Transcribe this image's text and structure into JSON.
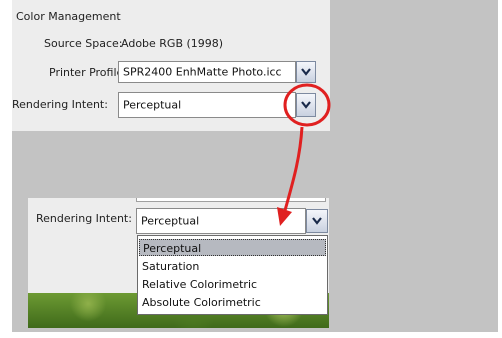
{
  "color_management": {
    "title": "Color Management",
    "source_space_label": "Source Space:",
    "source_space_value": "Adobe RGB (1998)",
    "printer_profile_label": "Printer Profile:",
    "printer_profile_value": "SPR2400 EnhMatte Photo.icc",
    "rendering_intent_label": "Rendering Intent:",
    "rendering_intent_value": "Perceptual"
  },
  "dropdown_expanded": {
    "rendering_intent_label": "Rendering Intent:",
    "rendering_intent_value": "Perceptual",
    "options": [
      "Perceptual",
      "Saturation",
      "Relative Colorimetric",
      "Absolute Colorimetric"
    ],
    "selected_index": 0
  },
  "colors": {
    "annotation": "#e02020",
    "highlight": "#b6b9c0"
  },
  "icons": {
    "dropdown_arrow": "chevron-down-icon"
  }
}
